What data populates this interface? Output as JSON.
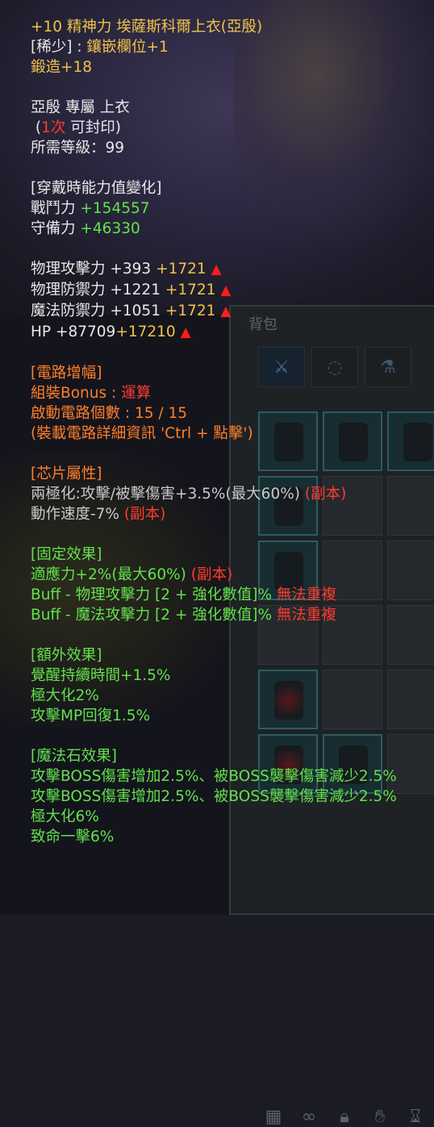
{
  "item": {
    "title": "+10 精神力 埃薩斯科爾上衣(亞殷)",
    "rarity_prefix": "[稀少] : ",
    "rarity_value": "鑲嵌欄位+1",
    "forge_label": "鍛造",
    "forge_value": "+18",
    "exclusive": "亞殷 專屬 上衣",
    "seal_open": "(",
    "seal_count": "1次",
    "seal_close": " 可封印)",
    "level_req": "所需等級：99"
  },
  "equip_change": {
    "header": "[穿戴時能力值變化]",
    "rows": [
      {
        "label": "戰鬥力",
        "value": "+154557"
      },
      {
        "label": "守備力",
        "value": "+46330"
      }
    ]
  },
  "stats": [
    {
      "label": "物理攻擊力 +393",
      "bonus": "+1721"
    },
    {
      "label": "物理防禦力 +1221",
      "bonus": "+1721"
    },
    {
      "label": "魔法防禦力 +1051",
      "bonus": "+1721"
    },
    {
      "label": "HP +87709",
      "bonus": "+17210"
    }
  ],
  "circuit": {
    "header": "[電路增幅]",
    "bonus_label": "組裝Bonus : ",
    "bonus_value": "運算",
    "count": "啟動電路個數 : 15 / 15",
    "hint": "(裝載電路詳細資訊 'Ctrl + 點擊')"
  },
  "chip": {
    "header": "[芯片屬性]",
    "line1": "兩極化:攻擊/被擊傷害+3.5%(最大60%)",
    "line1_tag": "(副本)",
    "line2": "動作速度-7%",
    "line2_tag": "(副本)"
  },
  "fixed": {
    "header": "[固定效果]",
    "line1": "適應力+2%(最大60%)",
    "line1_tag": "(副本)",
    "line2": "Buff - 物理攻擊力 [2 + 強化數值]%",
    "line2_tag": "無法重複",
    "line3": "Buff - 魔法攻擊力 [2 + 強化數值]%",
    "line3_tag": "無法重複"
  },
  "extra": {
    "header": "[額外效果]",
    "lines": [
      "覺醒持續時間+1.5%",
      "極大化2%",
      "攻擊MP回復1.5%"
    ]
  },
  "magic_stone": {
    "header": "[魔法石效果]",
    "lines": [
      "攻擊BOSS傷害增加2.5%、被BOSS襲擊傷害減少2.5%",
      "攻擊BOSS傷害增加2.5%、被BOSS襲擊傷害減少2.5%",
      "極大化6%",
      "致命一擊6%"
    ]
  },
  "inventory": {
    "title": "背包",
    "tab_icons": [
      "sword-icon",
      "necklace-icon",
      "potion-icon"
    ],
    "bottom_icons": [
      "grid-icon",
      "link-icon",
      "lock-icon",
      "hand-icon",
      "hourglass-icon"
    ]
  },
  "colors": {
    "gold": "#f0c24a",
    "green": "#62e24c",
    "orange": "#ff7f2a",
    "red": "#ff3b2e"
  }
}
